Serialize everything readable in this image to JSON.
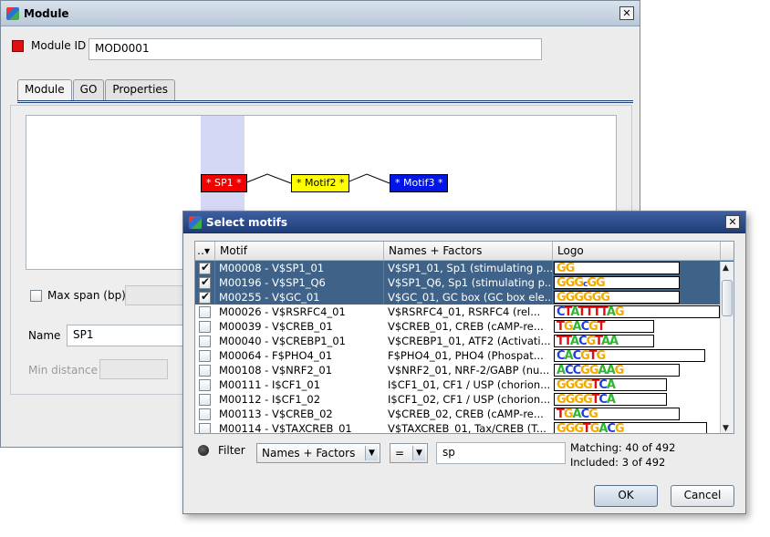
{
  "module_window": {
    "title": "Module",
    "close_glyph": "✕",
    "module_id_label": "Module ID",
    "module_id_value": "MOD0001",
    "tabs": [
      "Module",
      "GO",
      "Properties"
    ],
    "motifs": [
      "* SP1 *",
      "* Motif2 *",
      "* Motif3 *"
    ],
    "max_span_label": "Max span (bp)",
    "name_label": "Name",
    "name_value": "SP1",
    "min_distance_label": "Min distance"
  },
  "select_dialog": {
    "title": "Select motifs",
    "close_glyph": "✕",
    "columns": [
      "Motif",
      "Names + Factors",
      "Logo"
    ],
    "rows": [
      {
        "checked": true,
        "selected": true,
        "motif": "M00008 - V$SP1_01",
        "names": "V$SP1_01, Sp1 (stimulating p...",
        "logo": "GG"
      },
      {
        "checked": true,
        "selected": true,
        "motif": "M00196 - V$SP1_Q6",
        "names": "V$SP1_Q6, Sp1 (stimulating p...",
        "logo": "GGGcGG"
      },
      {
        "checked": true,
        "selected": true,
        "motif": "M00255 - V$GC_01",
        "names": "V$GC_01, GC box (GC box ele...",
        "logo": "GGGGGG"
      },
      {
        "checked": false,
        "selected": false,
        "motif": "M00026 - V$RSRFC4_01",
        "names": "V$RSRFC4_01, RSRFC4 (rel...",
        "logo": "CTATTTTAG"
      },
      {
        "checked": false,
        "selected": false,
        "motif": "M00039 - V$CREB_01",
        "names": "V$CREB_01, CREB (cAMP-re...",
        "logo": "TGACGT"
      },
      {
        "checked": false,
        "selected": false,
        "motif": "M00040 - V$CREBP1_01",
        "names": "V$CREBP1_01, ATF2 (Activati...",
        "logo": "TTACGTAA"
      },
      {
        "checked": false,
        "selected": false,
        "motif": "M00064 - F$PHO4_01",
        "names": "F$PHO4_01, PHO4 (Phospat...",
        "logo": "CACGTG"
      },
      {
        "checked": false,
        "selected": false,
        "motif": "M00108 - V$NRF2_01",
        "names": "V$NRF2_01, NRF-2/GABP (nu...",
        "logo": "ACCGGAAG"
      },
      {
        "checked": false,
        "selected": false,
        "motif": "M00111 - I$CF1_01",
        "names": "I$CF1_01, CF1 / USP (chorion...",
        "logo": "GGGGTCA"
      },
      {
        "checked": false,
        "selected": false,
        "motif": "M00112 - I$CF1_02",
        "names": "I$CF1_02, CF1 / USP (chorion...",
        "logo": "GGGGTCA"
      },
      {
        "checked": false,
        "selected": false,
        "motif": "M00113 - V$CREB_02",
        "names": "V$CREB_02, CREB (cAMP-re...",
        "logo": "TGACG"
      },
      {
        "checked": false,
        "selected": false,
        "motif": "M00114 - V$TAXCREB_01",
        "names": "V$TAXCREB_01, Tax/CREB (T...",
        "logo": "GGGTGACG"
      }
    ],
    "filter_label": "Filter",
    "filter_field": "Names + Factors",
    "filter_operator": "=",
    "filter_value": "sp",
    "matching": "Matching: 40 of 492",
    "included": "Included: 3 of 492",
    "ok_label": "OK",
    "cancel_label": "Cancel"
  },
  "logo_colors": {
    "A": "#2fb52f",
    "C": "#1f3fdc",
    "G": "#f2a900",
    "T": "#e01010"
  }
}
